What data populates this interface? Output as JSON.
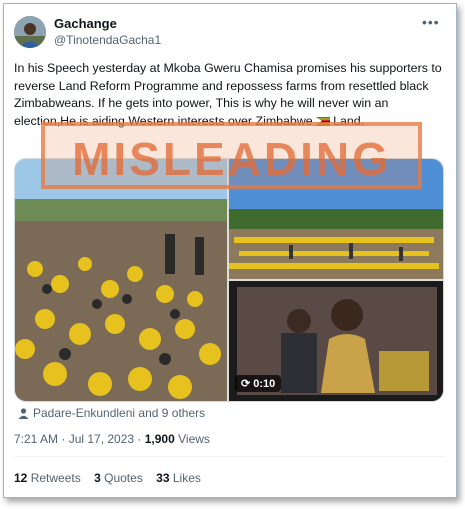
{
  "user": {
    "name": "Gachange",
    "handle": "@TinotendaGacha1"
  },
  "tweet": {
    "text": "In his Speech yesterday at Mkoba Gweru Chamisa promises his supporters to reverse Land Reform Programme and repossess farms from resettled black Zimbabweans. If he gets into power, This is why he will never win an election,He is aiding Western interests over Zimbabwe",
    "flag_icon": "zimbabwe-flag-icon",
    "text_end": "Land."
  },
  "stamp": {
    "label": "MISLEADING"
  },
  "media": {
    "video_duration": "0:10"
  },
  "tagged": {
    "text": "Padare-Enkundleni and 9 others"
  },
  "meta": {
    "time_date": "7:21 AM · Jul 17, 2023 · ",
    "views_count": "1,900",
    "views_label": " Views"
  },
  "stats": [
    {
      "count": "12",
      "label": "Retweets"
    },
    {
      "count": "3",
      "label": "Quotes"
    },
    {
      "count": "33",
      "label": "Likes"
    }
  ],
  "colors": {
    "stamp": "#e27037",
    "text": "#0f1419",
    "muted": "#536471"
  }
}
